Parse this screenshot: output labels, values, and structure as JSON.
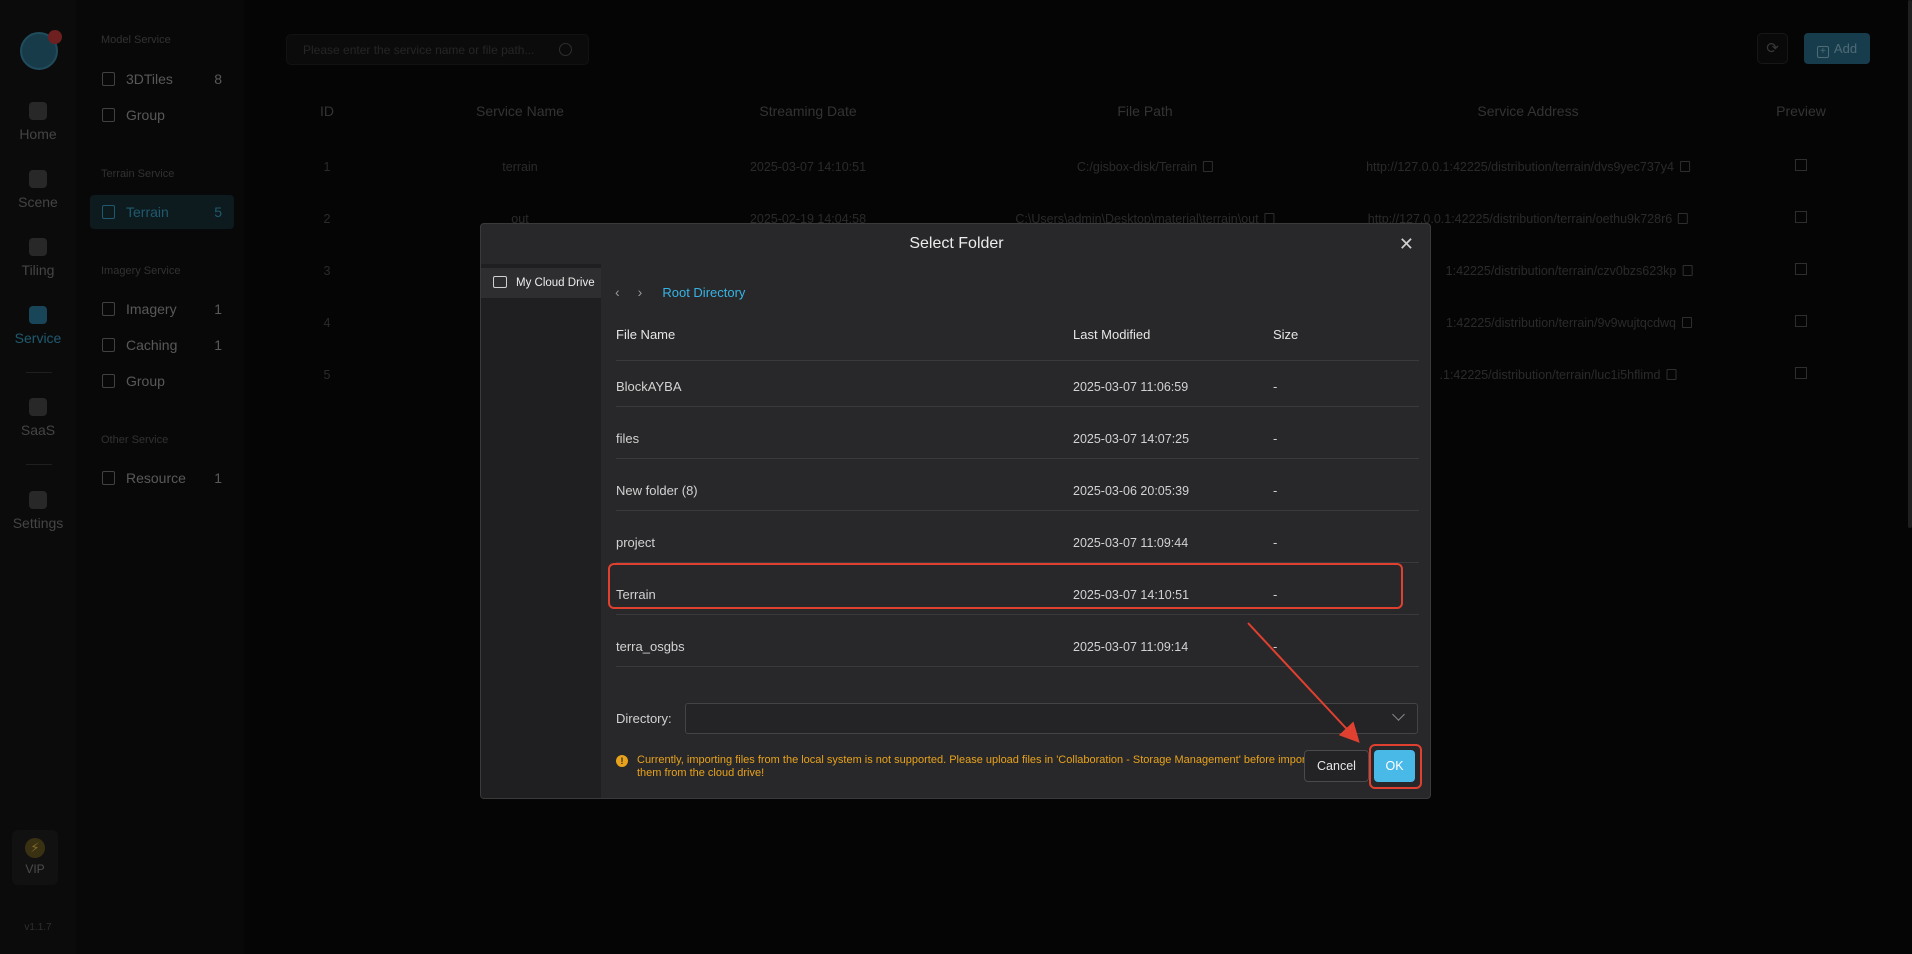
{
  "nav": {
    "items": [
      {
        "label": "Home",
        "icon": "home-icon"
      },
      {
        "label": "Scene",
        "icon": "scene-icon"
      },
      {
        "label": "Tiling",
        "icon": "tiling-icon"
      },
      {
        "label": "Service",
        "icon": "service-icon",
        "active": true
      },
      {
        "label": "SaaS",
        "icon": "saas-icon"
      },
      {
        "label": "Settings",
        "icon": "settings-icon"
      }
    ],
    "vip_label": "VIP",
    "version": "v1.1.7"
  },
  "sidebar": {
    "model_section": "Model Service",
    "model_items": [
      {
        "label": "3DTiles",
        "count": "8"
      },
      {
        "label": "Group",
        "count": ""
      }
    ],
    "terrain_section": "Terrain Service",
    "terrain_items": [
      {
        "label": "Terrain",
        "count": "5",
        "active": true
      }
    ],
    "imagery_section": "Imagery Service",
    "imagery_items": [
      {
        "label": "Imagery",
        "count": "1"
      },
      {
        "label": "Caching",
        "count": "1"
      },
      {
        "label": "Group",
        "count": ""
      }
    ],
    "other_section": "Other Service",
    "other_items": [
      {
        "label": "Resource",
        "count": "1"
      }
    ]
  },
  "toolbar": {
    "search_placeholder": "Please enter the service name or file path...",
    "add_label": "Add"
  },
  "table": {
    "columns": [
      "ID",
      "Service Name",
      "Streaming Date",
      "File Path",
      "Service Address",
      "Preview"
    ],
    "rows": [
      {
        "id": "1",
        "name": "terrain",
        "date": "2025-03-07 14:10:51",
        "path": "C:/gisbox-disk/Terrain",
        "address": "http://127.0.0.1:42225/distribution/terrain/dvs9yec737y4"
      },
      {
        "id": "2",
        "name": "out",
        "date": "2025-02-19 14:04:58",
        "path": "C:\\Users\\admin\\Desktop\\material\\terrain\\out",
        "address": "http://127.0.0.1:42225/distribution/terrain/oethu9k728r6"
      },
      {
        "id": "3",
        "name": "",
        "date": "",
        "path": "",
        "address": "1:42225/distribution/terrain/czv0bzs623kp"
      },
      {
        "id": "4",
        "name": "",
        "date": "",
        "path": "",
        "address": "1:42225/distribution/terrain/9v9wujtqcdwq"
      },
      {
        "id": "5",
        "name": "",
        "date": "",
        "path": "",
        "address": ".1:42225/distribution/terrain/luc1i5hflimd"
      }
    ]
  },
  "dialog": {
    "title": "Select Folder",
    "drive_label": "My Cloud Drive",
    "breadcrumb_root": "Root Directory",
    "columns": [
      "File Name",
      "Last Modified",
      "Size"
    ],
    "files": [
      {
        "name": "BlockAYBA",
        "modified": "2025-03-07 11:06:59",
        "size": "-"
      },
      {
        "name": "files",
        "modified": "2025-03-07 14:07:25",
        "size": "-"
      },
      {
        "name": "New folder (8)",
        "modified": "2025-03-06 20:05:39",
        "size": "-"
      },
      {
        "name": "project",
        "modified": "2025-03-07 11:09:44",
        "size": "-"
      },
      {
        "name": "Terrain",
        "modified": "2025-03-07 14:10:51",
        "size": "-",
        "highlighted": true
      },
      {
        "name": "terra_osgbs",
        "modified": "2025-03-07 11:09:14",
        "size": "-"
      }
    ],
    "directory_label": "Directory:",
    "directory_value": "",
    "warning": "Currently, importing files from the local system is not supported. Please upload files in 'Collaboration - Storage Management' before importing them from the cloud drive!",
    "cancel_label": "Cancel",
    "ok_label": "OK"
  },
  "colors": {
    "accent": "#3aa2c9",
    "primary_button": "#49b9e8",
    "warning": "#e8a21c",
    "annotation": "#e0402f"
  }
}
